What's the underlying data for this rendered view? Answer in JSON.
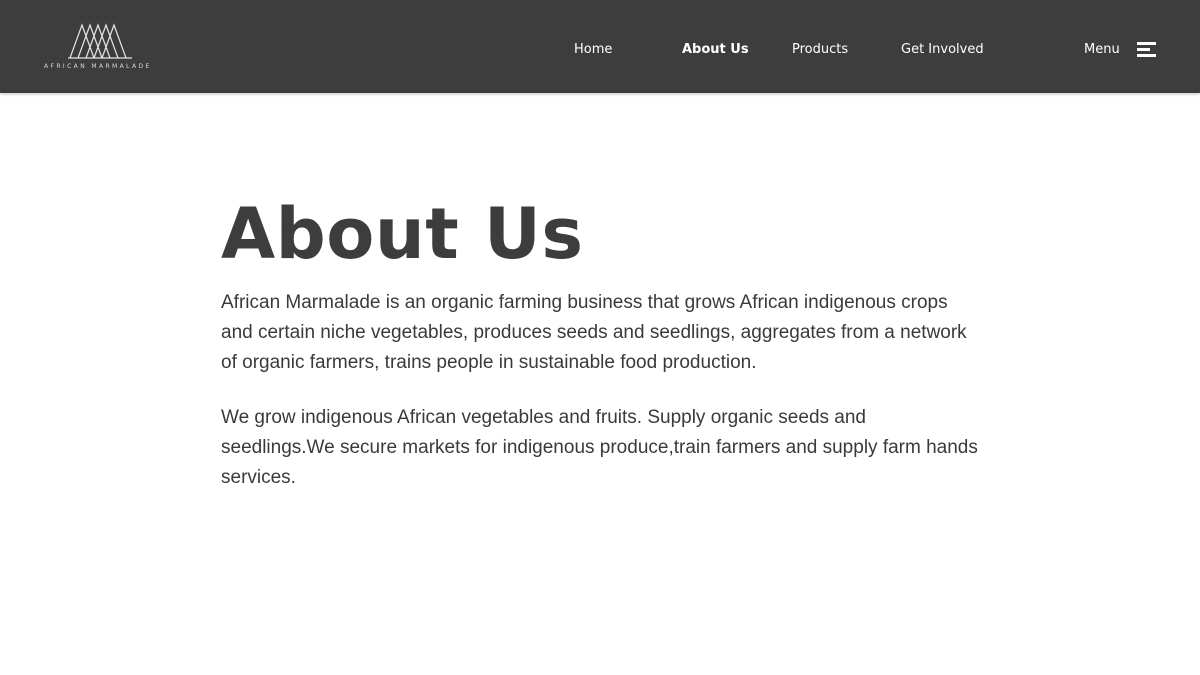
{
  "header": {
    "logo": {
      "text": "AFRICAN MARMALADE",
      "icon": "mountain-lines-logo"
    },
    "nav": [
      {
        "label": "Home",
        "active": false
      },
      {
        "label": "About Us",
        "active": true
      },
      {
        "label": "Products",
        "active": false
      },
      {
        "label": "Get Involved",
        "active": false
      }
    ],
    "menu": {
      "label": "Menu",
      "icon": "hamburger-icon"
    }
  },
  "main": {
    "title": "About Us",
    "paragraphs": [
      "African Marmalade is an organic farming business that grows African indigenous crops and certain niche vegetables, produces seeds and seedlings, aggregates from a network of organic farmers, trains people in sustainable food production.",
      "We grow indigenous African vegetables and fruits. Supply organic seeds and seedlings.We secure markets for indigenous produce,train farmers and supply farm hands services."
    ]
  },
  "colors": {
    "header_bg": "#3d3d3d",
    "title_text": "#3d3d3d",
    "body_text": "#3a3a3a",
    "nav_text": "#ffffff"
  }
}
